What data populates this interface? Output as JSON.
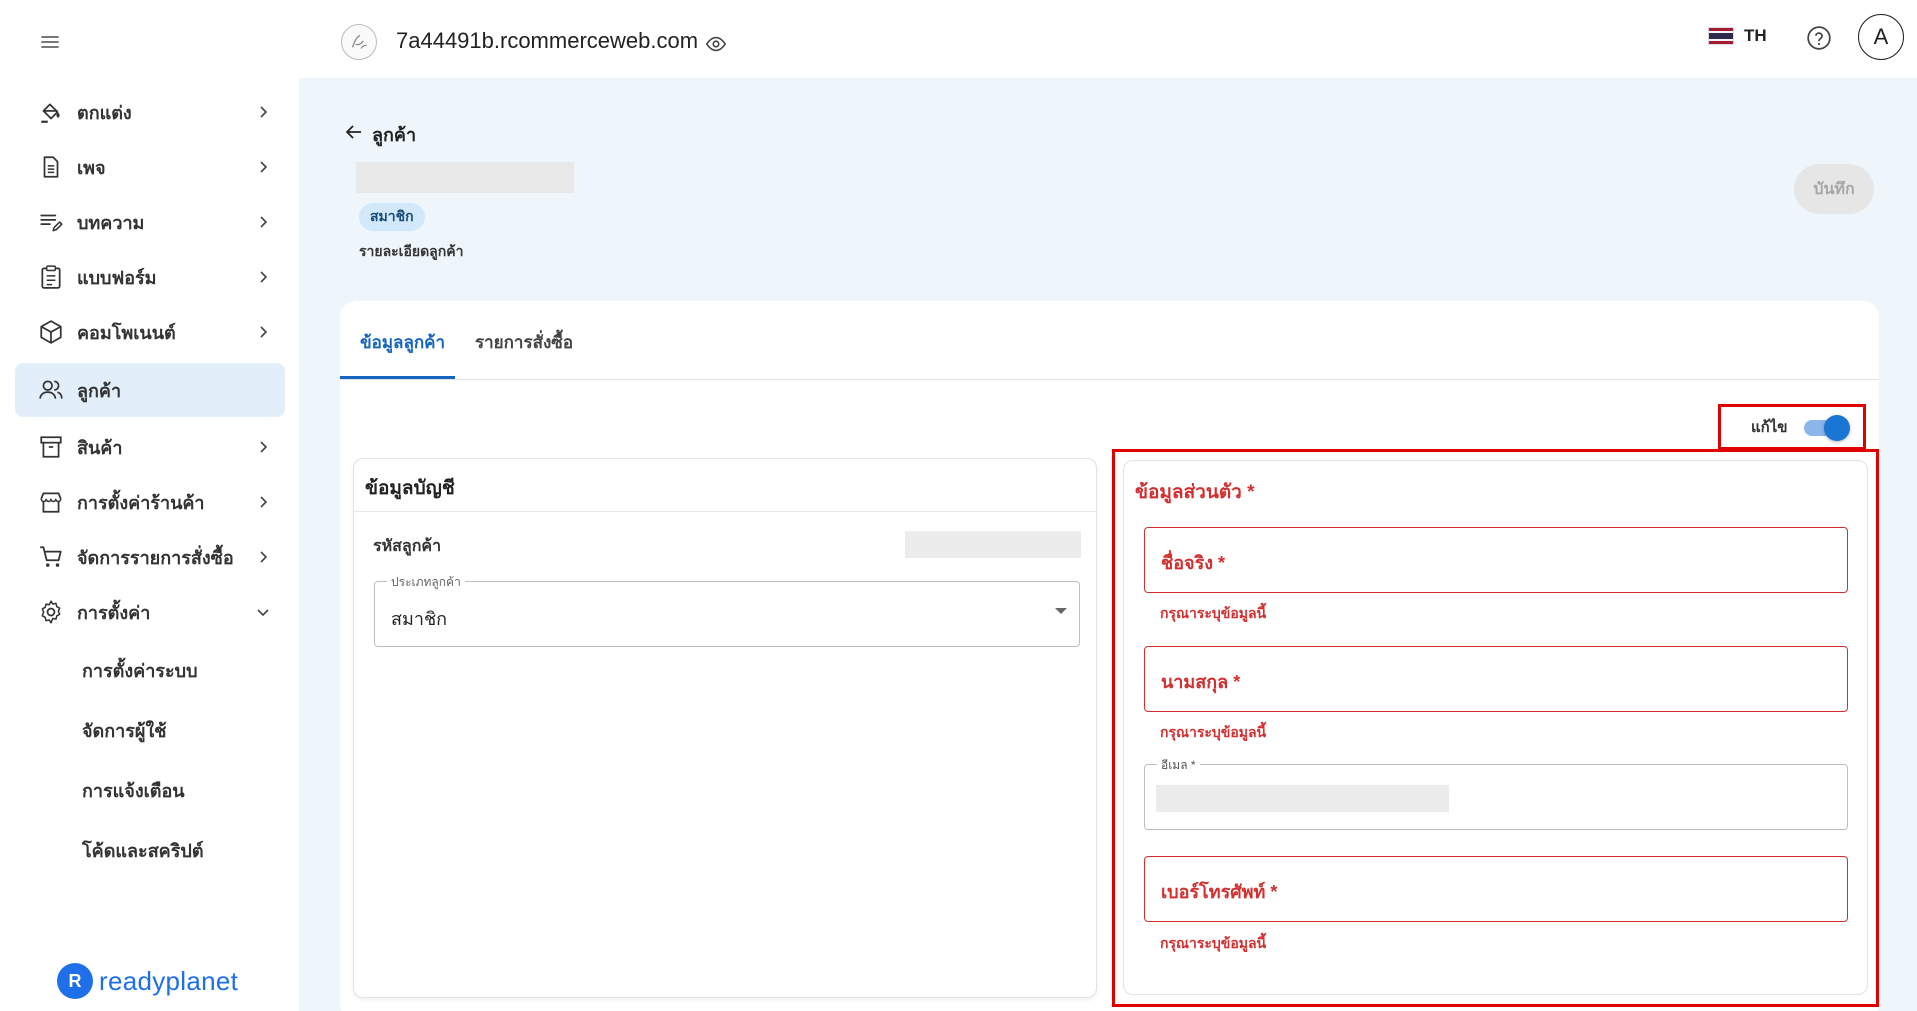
{
  "topbar": {
    "site_title": "7a44491b.rcommerceweb.com",
    "lang_label": "TH",
    "user_initial": "A"
  },
  "sidebar": {
    "items": [
      {
        "label": "ตกแต่ง",
        "icon": "paint-bucket-icon"
      },
      {
        "label": "เพจ",
        "icon": "page-icon"
      },
      {
        "label": "บทความ",
        "icon": "article-icon"
      },
      {
        "label": "แบบฟอร์ม",
        "icon": "form-icon"
      },
      {
        "label": "คอมโพเนนต์",
        "icon": "component-icon"
      },
      {
        "label": "ลูกค้า",
        "icon": "customers-icon",
        "active": true
      },
      {
        "label": "สินค้า",
        "icon": "product-icon"
      },
      {
        "label": "การตั้งค่าร้านค้า",
        "icon": "store-icon"
      },
      {
        "label": "จัดการรายการสั่งซื้อ",
        "icon": "cart-icon"
      },
      {
        "label": "การตั้งค่า",
        "icon": "gear-icon",
        "expanded": true
      }
    ],
    "settings_sub": [
      "การตั้งค่าระบบ",
      "จัดการผู้ใช้",
      "การแจ้งเตือน",
      "โค้ดและสคริปต์"
    ],
    "logo_text": "readyplanet"
  },
  "page": {
    "back_label": "ลูกค้า",
    "member_badge": "สมาชิก",
    "subtitle": "รายละเอียดลูกค้า",
    "save_label": "บันทึก"
  },
  "tabs": [
    "ข้อมูลลูกค้า",
    "รายการสั่งซื้อ"
  ],
  "edit_toggle": {
    "label": "แก้ไข",
    "on": true
  },
  "account": {
    "title": "ข้อมูลบัญชี",
    "customer_code_label": "รหัสลูกค้า",
    "customer_type_label": "ประเภทลูกค้า",
    "customer_type_value": "สมาชิก"
  },
  "personal": {
    "title": "ข้อมูลส่วนตัว *",
    "first_name_label": "ชื่อจริง *",
    "last_name_label": "นามสกุล *",
    "email_label": "อีเมล *",
    "phone_label": "เบอร์โทรศัพท์ *",
    "error_text": "กรุณาระบุข้อมูลนี้"
  },
  "colors": {
    "accent": "#1565c0",
    "error": "#d32f2f",
    "highlight": "#e00000",
    "active_nav_bg": "#e3eefb",
    "flag": [
      "#a51931",
      "#f4f5f8",
      "#2d2a4a",
      "#f4f5f8",
      "#a51931"
    ]
  }
}
